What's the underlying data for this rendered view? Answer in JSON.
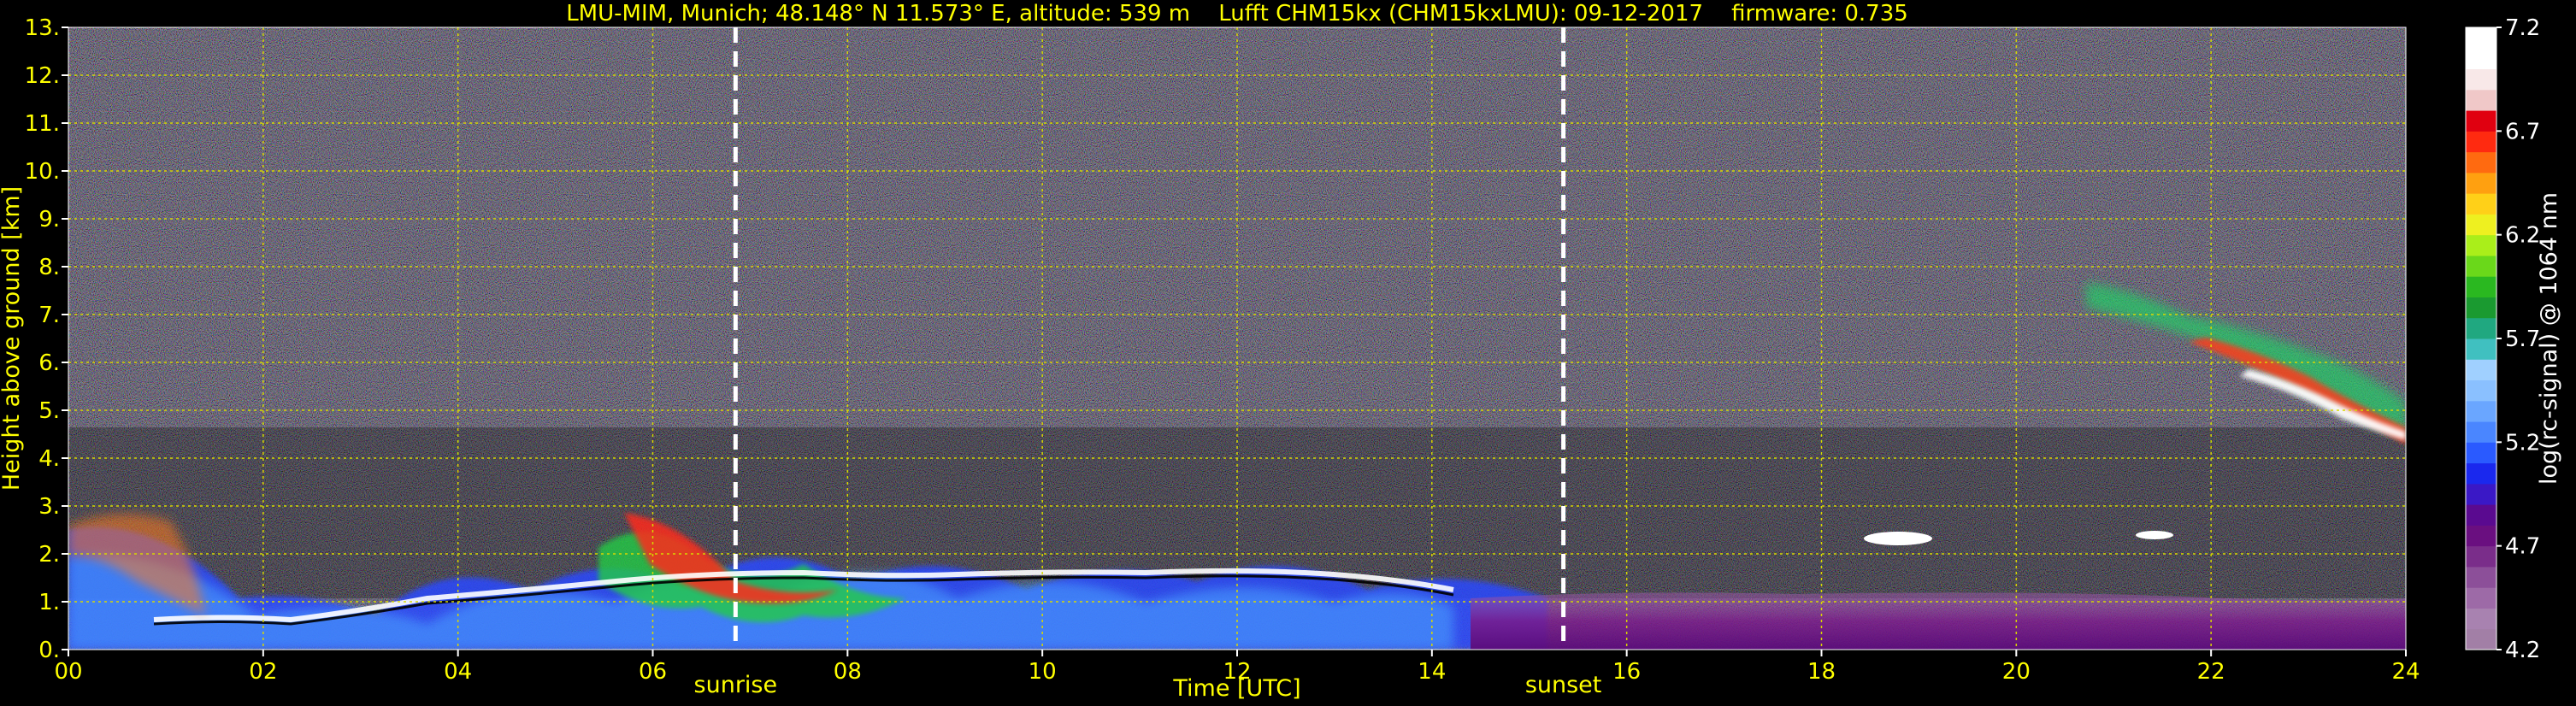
{
  "chart_data": {
    "type": "heatmap",
    "title": "LMU-MIM, Munich; 48.148° N 11.573° E, altitude: 539 m    Lufft CHM15kx (CHM15kxLMU): 09-12-2017    firmware: 0.735",
    "xlabel": "Time [UTC]",
    "ylabel": "Height above ground [km]",
    "xlim": [
      0,
      24
    ],
    "ylim": [
      0,
      13
    ],
    "x_ticks": [
      "00",
      "02",
      "04",
      "06",
      "08",
      "10",
      "12",
      "14",
      "16",
      "18",
      "20",
      "22",
      "24"
    ],
    "y_ticks": [
      "0.",
      "1.",
      "2.",
      "3.",
      "4.",
      "5.",
      "6.",
      "7.",
      "8.",
      "9.",
      "10.",
      "11.",
      "12.",
      "13."
    ],
    "grid": true,
    "markers": [
      {
        "label": "sunrise",
        "x": 6.85
      },
      {
        "label": "sunset",
        "x": 15.35
      }
    ],
    "colorbar": {
      "label": "log(rc-signal) @ 1064 nm",
      "range": [
        4.2,
        7.2
      ],
      "ticks": [
        "4.2",
        "4.7",
        "5.2",
        "5.7",
        "6.2",
        "6.7",
        "7.2"
      ]
    },
    "features": [
      {
        "kind": "aerosol_layer",
        "x": [
          0,
          14.5
        ],
        "height_km": [
          0,
          1.6
        ]
      },
      {
        "kind": "boundary_layer_top",
        "x": [
          0,
          14.2
        ],
        "height_km": [
          0.6,
          1.6
        ]
      },
      {
        "kind": "residual_layer",
        "x": [
          15.3,
          24
        ],
        "height_km": [
          0,
          1.3
        ]
      },
      {
        "kind": "cloud",
        "x": [
          20.0,
          24.0
        ],
        "height_km": [
          4.0,
          7.2
        ]
      },
      {
        "kind": "cloud",
        "x": [
          18.7,
          19.3
        ],
        "height_km": [
          2.2,
          2.4
        ]
      },
      {
        "kind": "cloud",
        "x": [
          21.3,
          21.7
        ],
        "height_km": [
          2.4,
          2.6
        ]
      }
    ],
    "colors": {
      "text": "#ffff00",
      "grid": "#d8d800",
      "marker": "#ffffff",
      "background": "#000000"
    }
  }
}
